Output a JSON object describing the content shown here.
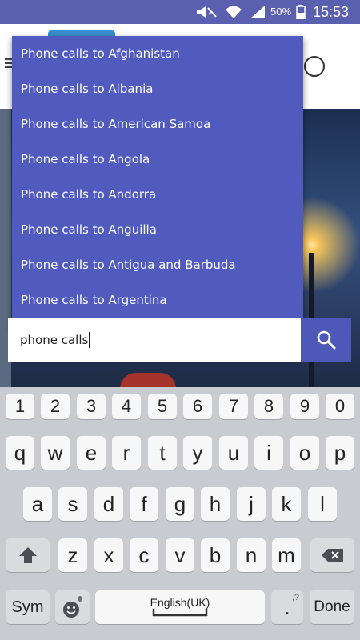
{
  "status_bar": {
    "battery_percent": "50%",
    "time": "15:53",
    "icons": [
      "mute-icon",
      "wifi-icon",
      "signal-icon",
      "battery-icon"
    ]
  },
  "dropdown": {
    "items": [
      "Phone calls to Afghanistan",
      "Phone calls to Albania",
      "Phone calls to American Samoa",
      "Phone calls to Angola",
      "Phone calls to Andorra",
      "Phone calls to Anguilla",
      "Phone calls to Antigua and Barbuda",
      "Phone calls to Argentina"
    ]
  },
  "search": {
    "value": "phone calls",
    "button_icon": "search-icon"
  },
  "keyboard": {
    "number_row": [
      "1",
      "2",
      "3",
      "4",
      "5",
      "6",
      "7",
      "8",
      "9",
      "0"
    ],
    "row1": [
      "q",
      "w",
      "e",
      "r",
      "t",
      "y",
      "u",
      "i",
      "o",
      "p"
    ],
    "row2": [
      "a",
      "s",
      "d",
      "f",
      "g",
      "h",
      "j",
      "k",
      "l"
    ],
    "row3": [
      "z",
      "x",
      "c",
      "v",
      "b",
      "n",
      "m"
    ],
    "sym_label": "Sym",
    "space_label": "English(UK)",
    "period_label": ".",
    "period_hint": ",?",
    "done_label": "Done",
    "colors": {
      "background": "#c8ccd0",
      "key": "#f7f7f8"
    }
  },
  "colors": {
    "status_bar": "#5a5fb0",
    "dropdown": "#515bbd",
    "search_button": "#4e58b8"
  }
}
